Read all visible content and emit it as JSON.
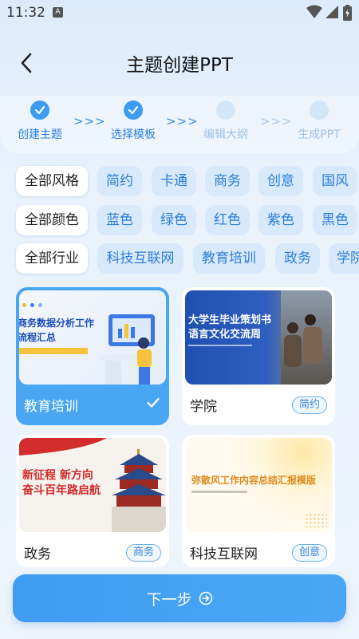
{
  "status_bar": {
    "time": "11:32",
    "notif_letter": "A"
  },
  "header": {
    "title": "主题创建PPT"
  },
  "steps": [
    {
      "label": "创建主题",
      "state": "done"
    },
    {
      "label": "选择模板",
      "state": "done"
    },
    {
      "label": "编辑大纲",
      "state": "todo"
    },
    {
      "label": "生成PPT",
      "state": "todo"
    }
  ],
  "filters": {
    "style": {
      "all": "全部风格",
      "options": [
        "简约",
        "卡通",
        "商务",
        "创意",
        "国风"
      ]
    },
    "color": {
      "all": "全部颜色",
      "options": [
        "蓝色",
        "绿色",
        "红色",
        "紫色",
        "黑色"
      ]
    },
    "industry": {
      "all": "全部行业",
      "options": [
        "科技互联网",
        "教育培训",
        "政务",
        "学院"
      ]
    }
  },
  "cards": [
    {
      "title": "教育培训",
      "tag": "",
      "selected": true,
      "thumb_lines": [
        "商务数据分析工作",
        "流程汇总"
      ]
    },
    {
      "title": "学院",
      "tag": "简约",
      "selected": false,
      "thumb_lines": [
        "大学生毕业策划书",
        "语言文化交流周"
      ]
    },
    {
      "title": "政务",
      "tag": "商务",
      "selected": false,
      "thumb_lines": [
        "新征程 新方向",
        "奋斗百年路启航"
      ]
    },
    {
      "title": "科技互联网",
      "tag": "创意",
      "selected": false,
      "thumb_lines": [
        "弥散风工作内容总结汇报模版"
      ]
    }
  ],
  "next_button": {
    "label": "下一步"
  },
  "colors": {
    "accent": "#3b9df2",
    "chip_bg": "#d7e9fb",
    "chip_text": "#2f7fd8",
    "selected_card": "#49a6f3"
  }
}
